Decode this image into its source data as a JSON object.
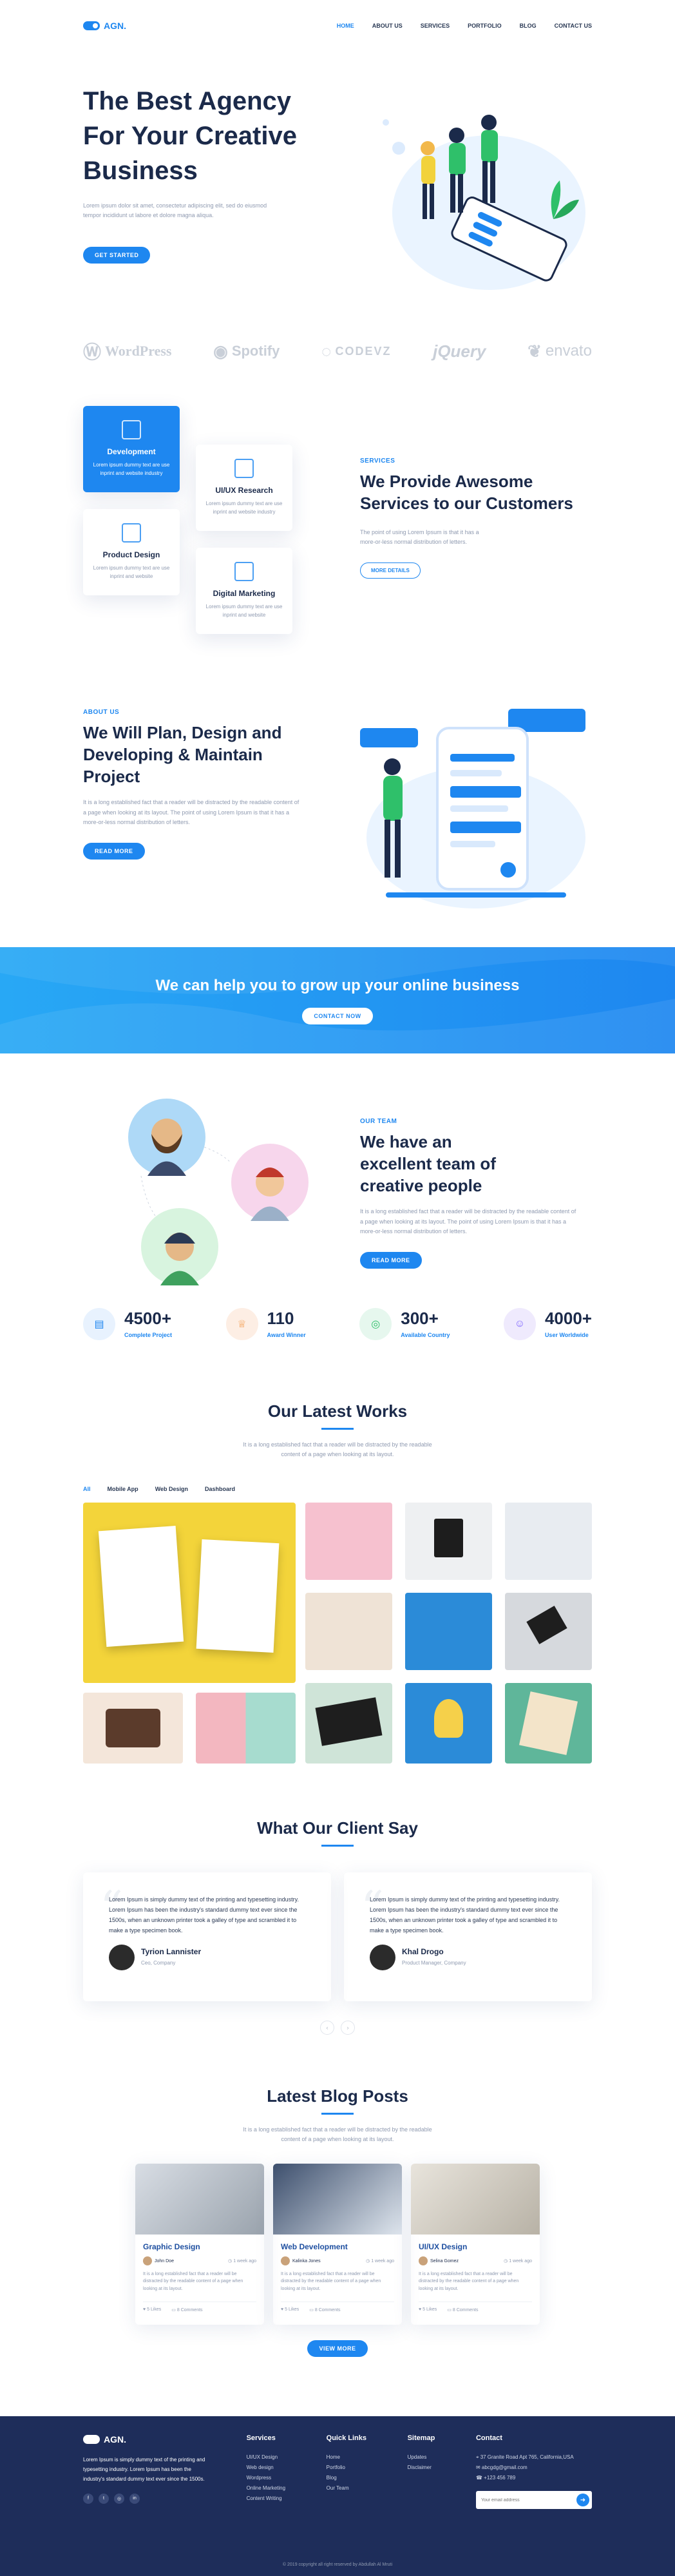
{
  "header": {
    "logo": "AGN.",
    "menu": [
      "HOME",
      "ABOUT US",
      "SERVICES",
      "PORTFOLIO",
      "BLOG",
      "CONTACT US"
    ]
  },
  "hero": {
    "title": "The Best Agency For Your Creative Business",
    "text": "Lorem ipsum dolor sit amet, consectetur adipiscing elit, sed do eiusmod tempor incididunt ut labore et dolore magna aliqua.",
    "button": "GET STARTED"
  },
  "brands": [
    "WordPress",
    "Spotify",
    "CODEVZ",
    "jQuery",
    "envato"
  ],
  "services": {
    "cards": [
      {
        "title": "Development",
        "text": "Lorem ipsum dummy text are use inprint and website industry"
      },
      {
        "title": "UI/UX Research",
        "text": "Lorem ipsum dummy text are use inprint and website industry"
      },
      {
        "title": "Product Design",
        "text": "Lorem ipsum dummy text are use inprint and website"
      },
      {
        "title": "Digital Marketing",
        "text": "Lorem ipsum dummy text are use inprint and website"
      }
    ],
    "eyebrow": "SERVICES",
    "title": "We Provide Awesome Services to our Customers",
    "text": "The point of using Lorem Ipsum is that it has a more-or-less normal distribution of letters.",
    "button": "MORE DETAILS"
  },
  "about": {
    "eyebrow": "ABOUT US",
    "title": "We Will Plan, Design and Developing & Maintain Project",
    "text": "It is a long established fact that a reader will be distracted by the readable content of a page when looking at its layout. The point of using Lorem Ipsum is that it has a more-or-less normal distribution of letters.",
    "button": "READ MORE"
  },
  "banner": {
    "title": "We can help you to grow up your online business",
    "button": "CONTACT NOW"
  },
  "team": {
    "eyebrow": "OUR TEAM",
    "title": "We have an excellent team of creative people",
    "text": "It is a long established fact that a reader will be distracted by the readable content of a page when looking at its layout. The point of using Lorem Ipsum is that it has a more-or-less normal distribution of letters.",
    "button": "READ MORE"
  },
  "stats": [
    {
      "value": "4500+",
      "label": "Complete Project",
      "color": "#e8f2fe"
    },
    {
      "value": "110",
      "label": "Award Winner",
      "color": "#fdeee4"
    },
    {
      "value": "300+",
      "label": "Available Country",
      "color": "#e6f7ee"
    },
    {
      "value": "4000+",
      "label": "User Worldwide",
      "color": "#efeafd"
    }
  ],
  "works": {
    "title": "Our Latest Works",
    "text": "It is a long established fact that a reader will be distracted by the readable content of a page when looking at its layout.",
    "filters": [
      "All",
      "Mobile App",
      "Web Design",
      "Dashboard"
    ]
  },
  "clients": {
    "title": "What Our Client Say",
    "items": [
      {
        "text": "Lorem Ipsum is simply dummy text of the printing and typesetting industry. Lorem Ipsum has been the industry's standard dummy text ever since the 1500s, when an unknown printer took a galley of type and scrambled it to make a type specimen book.",
        "name": "Tyrion Lannister",
        "role": "Ceo, Company"
      },
      {
        "text": "Lorem Ipsum is simply dummy text of the printing and typesetting industry. Lorem Ipsum has been the industry's standard dummy text ever since the 1500s, when an unknown printer took a galley of type and scrambled it to make a type specimen book.",
        "name": "Khal Drogo",
        "role": "Product Manager, Company"
      }
    ]
  },
  "blog": {
    "title": "Latest Blog Posts",
    "text": "It is a long established fact that a reader will be distracted by the readable content of a page when looking at its layout.",
    "posts": [
      {
        "title": "Graphic Design",
        "author": "John Doe",
        "date": "1 week ago",
        "text": "It is a long established fact that a reader will be distracted by the readable content of a page when looking at its layout.",
        "likes": "5 Likes",
        "comments": "8 Comments"
      },
      {
        "title": "Web Development",
        "author": "Kalinka Jones",
        "date": "1 week ago",
        "text": "It is a long established fact that a reader will be distracted by the readable content of a page when looking at its layout.",
        "likes": "5 Likes",
        "comments": "8 Comments"
      },
      {
        "title": "UI/UX Design",
        "author": "Selina Gomez",
        "date": "1 week ago",
        "text": "It is a long established fact that a reader will be distracted by the readable content of a page when looking at its layout.",
        "likes": "5 Likes",
        "comments": "8 Comments"
      }
    ],
    "button": "VIEW MORE"
  },
  "footer": {
    "logo": "AGN.",
    "about": "Lorem Ipsum is simply dummy text of the printing and typesetting industry. Lorem Ipsum has been the industry's standard dummy text ever since the 1500s.",
    "services_title": "Services",
    "services": [
      "UI/UX Design",
      "Web design",
      "Wordpress",
      "Online Marketing",
      "Content Writing"
    ],
    "links_title": "Quick Links",
    "links": [
      "Home",
      "Portfolio",
      "Blog",
      "Our Team"
    ],
    "sitemap_title": "Sitemap",
    "sitemap": [
      "Updates",
      "Disclaimer"
    ],
    "contact_title": "Contact",
    "contact": [
      "37 Granite Road Apt 765, California,USA",
      "abcgdg@gmail.com",
      "+123 456 789"
    ],
    "email_placeholder": "Your email address",
    "copyright": "© 2019 copyright all right reserved by Abdullah Al Mruti"
  }
}
